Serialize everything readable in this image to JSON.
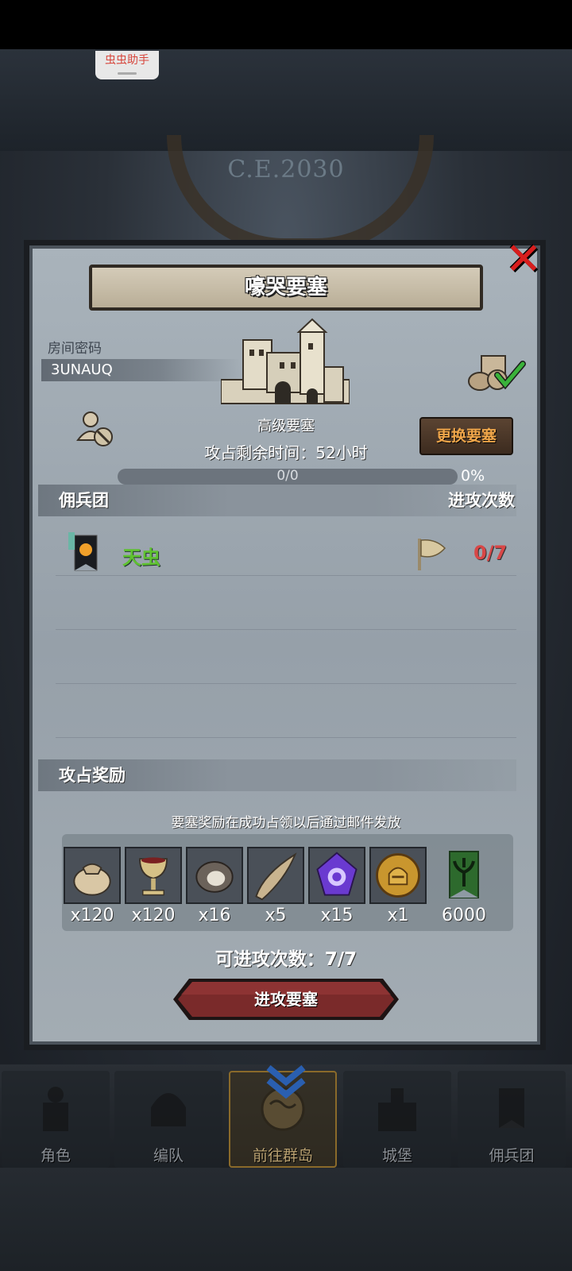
{
  "assistant": {
    "label": "虫虫助手"
  },
  "background": {
    "year": "C.E.2030"
  },
  "dialog": {
    "title": "嚎哭要塞",
    "room_label": "房间密码",
    "room_code": "3UNAUQ",
    "fortress_name": "高级要塞",
    "change_button": "更换要塞",
    "time_left": "攻占剩余时间：52小时",
    "progress": {
      "text": "0/0",
      "percent_text": "0%",
      "fraction": 0
    },
    "mercenary_header": "佣兵团",
    "attacks_header": "进攻次数",
    "guilds": [
      {
        "name": "天虫",
        "attacks": "0/7"
      }
    ],
    "rewards_header": "攻占奖励",
    "rewards_note": "要塞奖励在成功占领以后通过邮件发放",
    "rewards": [
      {
        "icon": "sack-icon",
        "qty": "x120"
      },
      {
        "icon": "goblet-icon",
        "qty": "x120"
      },
      {
        "icon": "truffle-icon",
        "qty": "x16"
      },
      {
        "icon": "horn-icon",
        "qty": "x5"
      },
      {
        "icon": "purple-crystal-icon",
        "qty": "x15"
      },
      {
        "icon": "knight-medal-icon",
        "qty": "x1"
      },
      {
        "icon": "guild-banner-icon",
        "qty": "6000"
      }
    ],
    "attacks_available": "可进攻次数：7/7",
    "attack_button": "进攻要塞"
  },
  "nav": {
    "tabs": [
      {
        "label": "角色",
        "icon": "knight-icon"
      },
      {
        "label": "编队",
        "icon": "helmet-icon"
      },
      {
        "label": "前往群岛",
        "icon": "globe-icon"
      },
      {
        "label": "城堡",
        "icon": "castle-icon"
      },
      {
        "label": "佣兵团",
        "icon": "mercenary-icon"
      }
    ]
  },
  "colors": {
    "guild_name": "#5fc230",
    "attack_count": "#d84747",
    "change_button_text": "#f0a64a",
    "close": "#d81e1e"
  }
}
